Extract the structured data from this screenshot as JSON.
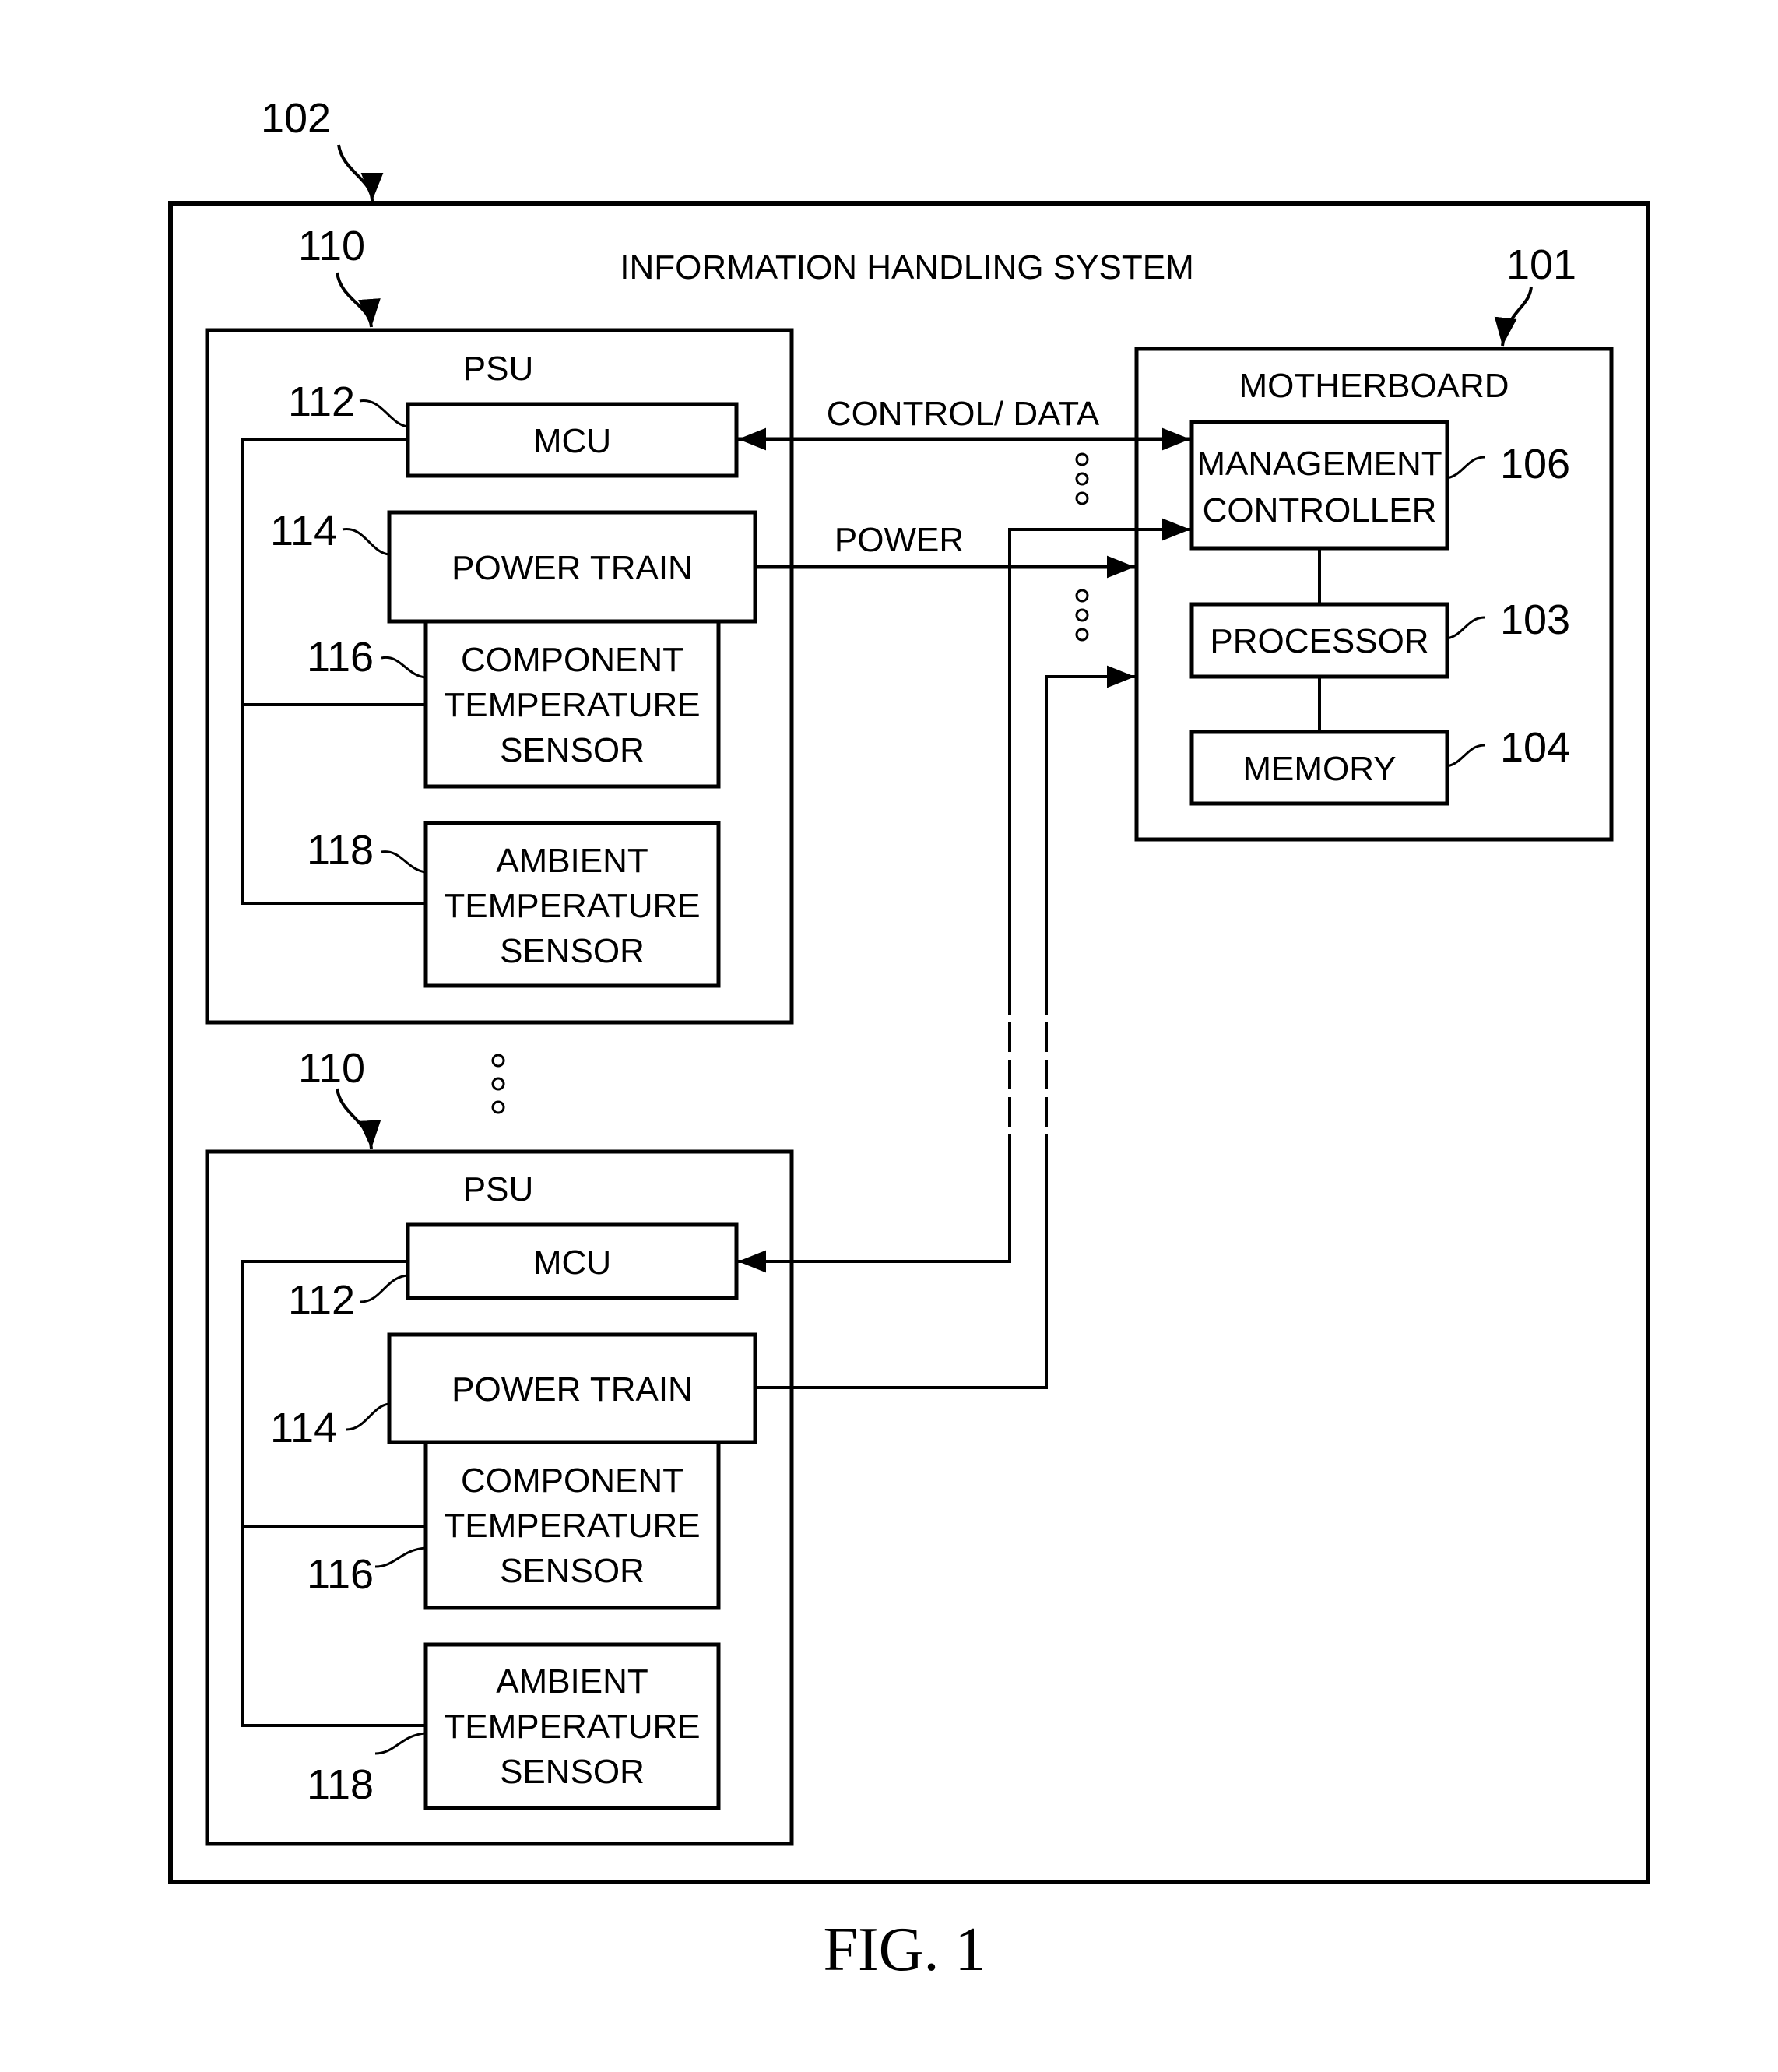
{
  "figure": {
    "caption": "FIG. 1",
    "system": {
      "ref": "102",
      "title": "INFORMATION HANDLING SYSTEM"
    },
    "psus": [
      {
        "ref": "110",
        "title": "PSU",
        "mcu": {
          "ref": "112",
          "label": "MCU"
        },
        "power_train": {
          "ref": "114",
          "label": "POWER TRAIN"
        },
        "component_sensor": {
          "ref": "116",
          "lines": [
            "COMPONENT",
            "TEMPERATURE",
            "SENSOR"
          ]
        },
        "ambient_sensor": {
          "ref": "118",
          "lines": [
            "AMBIENT",
            "TEMPERATURE",
            "SENSOR"
          ]
        }
      },
      {
        "ref": "110",
        "title": "PSU",
        "mcu": {
          "ref": "112",
          "label": "MCU"
        },
        "power_train": {
          "ref": "114",
          "label": "POWER TRAIN"
        },
        "component_sensor": {
          "ref": "116",
          "lines": [
            "COMPONENT",
            "TEMPERATURE",
            "SENSOR"
          ]
        },
        "ambient_sensor": {
          "ref": "118",
          "lines": [
            "AMBIENT",
            "TEMPERATURE",
            "SENSOR"
          ]
        }
      }
    ],
    "motherboard": {
      "ref": "101",
      "title": "MOTHERBOARD",
      "management_controller": {
        "ref": "106",
        "lines": [
          "MANAGEMENT",
          "CONTROLLER"
        ]
      },
      "processor": {
        "ref": "103",
        "label": "PROCESSOR"
      },
      "memory": {
        "ref": "104",
        "label": "MEMORY"
      }
    },
    "connections": {
      "control_data": "CONTROL/ DATA",
      "power": "POWER"
    }
  }
}
